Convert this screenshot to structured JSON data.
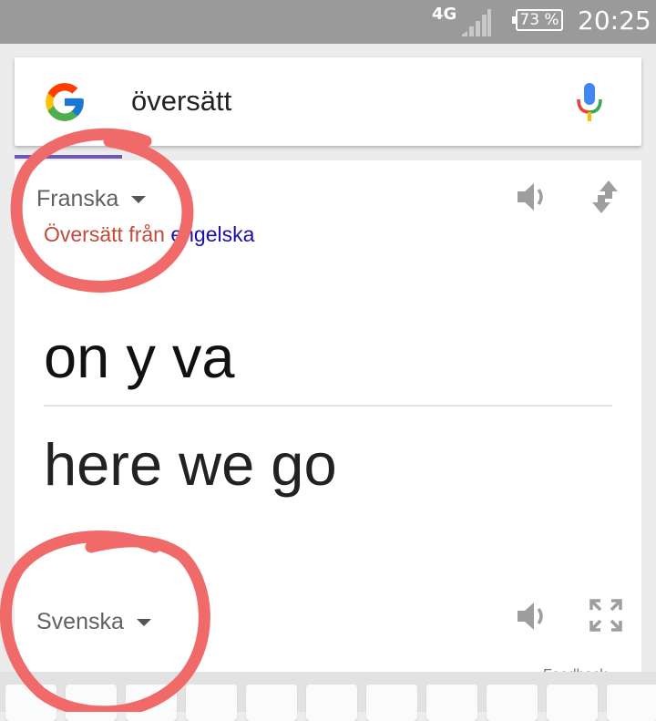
{
  "status_bar": {
    "network": "4G",
    "battery": "73 %",
    "time": "20:25"
  },
  "search": {
    "query": "översätt"
  },
  "translator": {
    "source_language": "Franska",
    "hint_prefix": "Översätt från ",
    "hint_language": "engelska",
    "source_text": "on y va",
    "target_text": "here we go",
    "target_language": "Svenska",
    "feedback_partial": "Feedback"
  },
  "colors": {
    "status_bar": "#9a9a9a",
    "hint": "#c14a3a",
    "hint_link": "#1a0dab",
    "tab_accent": "#6f57b3",
    "annotation_circle": "#f06a6a"
  },
  "icons": [
    "signal-icon",
    "battery-icon",
    "google-logo",
    "mic-icon",
    "speaker-icon",
    "swap-icon",
    "expand-icon"
  ]
}
